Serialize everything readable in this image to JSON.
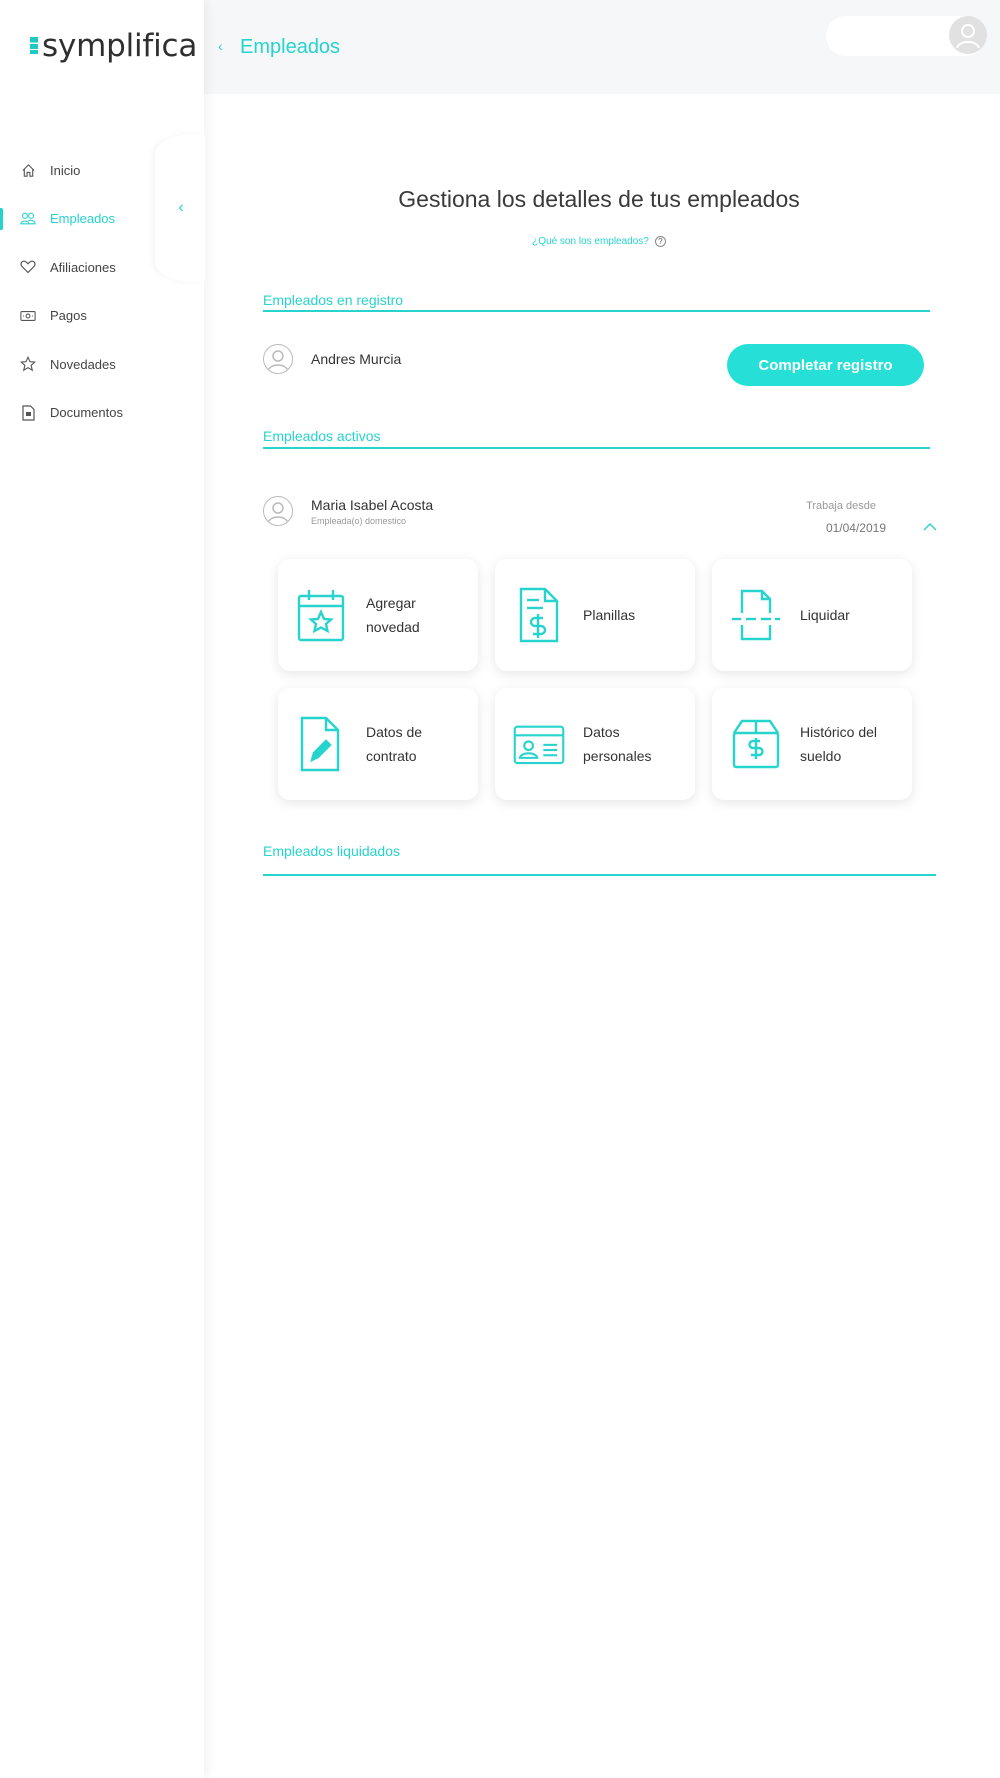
{
  "sidebar": {
    "logo": "symplifica",
    "items": [
      {
        "label": "Inicio",
        "icon": "home-icon",
        "active": false
      },
      {
        "label": "Empleados",
        "icon": "users-icon",
        "active": true
      },
      {
        "label": "Afiliaciones",
        "icon": "heart-icon",
        "active": false
      },
      {
        "label": "Pagos",
        "icon": "money-icon",
        "active": false
      },
      {
        "label": "Novedades",
        "icon": "star-icon",
        "active": false
      },
      {
        "label": "Documentos",
        "icon": "document-icon",
        "active": false
      }
    ],
    "collapse_icon": "chevron-left-icon"
  },
  "header": {
    "back_icon": "chevron-left-icon",
    "title": "Empleados",
    "user_icon": "user-avatar-icon"
  },
  "main": {
    "title": "Gestiona los detalles de tus empleados",
    "help_link": "¿Qué son los empleados?",
    "help_icon": "question-circle-icon",
    "registro": {
      "title": "Empleados en registro",
      "employee": "Andres Murcia",
      "button": "Completar registro"
    },
    "activos": {
      "title": "Empleados activos",
      "employee": "Maria Isabel Acosta",
      "role": "Empleada(o) domestico",
      "since_label": "Trabaja desde",
      "since_date": "01/04/2019",
      "cards": [
        {
          "label": "Agregar\nnovedad",
          "icon": "calendar-star-icon"
        },
        {
          "label": "Planillas",
          "icon": "document-dollar-icon"
        },
        {
          "label": "Liquidar",
          "icon": "document-cut-icon"
        },
        {
          "label": "Datos de\ncontrato",
          "icon": "document-pen-icon"
        },
        {
          "label": "Datos\npersonales",
          "icon": "id-card-icon"
        },
        {
          "label": "Histórico del\nsueldo",
          "icon": "box-dollar-icon"
        }
      ]
    },
    "liquidados": {
      "title": "Empleados liquidados"
    }
  },
  "colors": {
    "accent": "#26d3cd",
    "button": "#26e0d7",
    "header_bg": "#f6f7f9"
  }
}
